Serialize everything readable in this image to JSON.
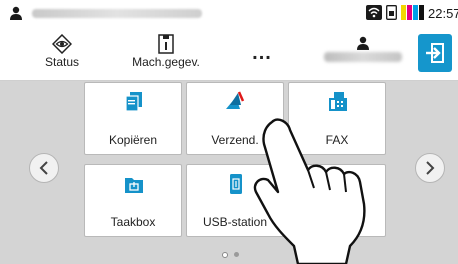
{
  "status_bar": {
    "time": "22:57",
    "toner_colors": [
      "#f2d600",
      "#e4007f",
      "#00a0e9",
      "#111111"
    ]
  },
  "toolbar": {
    "status_label": "Status",
    "machine_label": "Mach.gegev.",
    "more_label": "..."
  },
  "tiles": [
    {
      "label": "Kopiëren",
      "icon": "copy-icon"
    },
    {
      "label": "Verzend.",
      "icon": "send-icon"
    },
    {
      "label": "FAX",
      "icon": "fax-icon"
    },
    {
      "label": "Taakbox",
      "icon": "job-box-icon"
    },
    {
      "label": "USB-station",
      "icon": "usb-drive-icon"
    },
    {
      "label": "res",
      "icon": "address-icon"
    }
  ],
  "pager": {
    "pages": 2,
    "current": 1
  },
  "colors": {
    "accent": "#1596cc",
    "icon_blue": "#1592c9",
    "background": "#d4d4d4"
  }
}
